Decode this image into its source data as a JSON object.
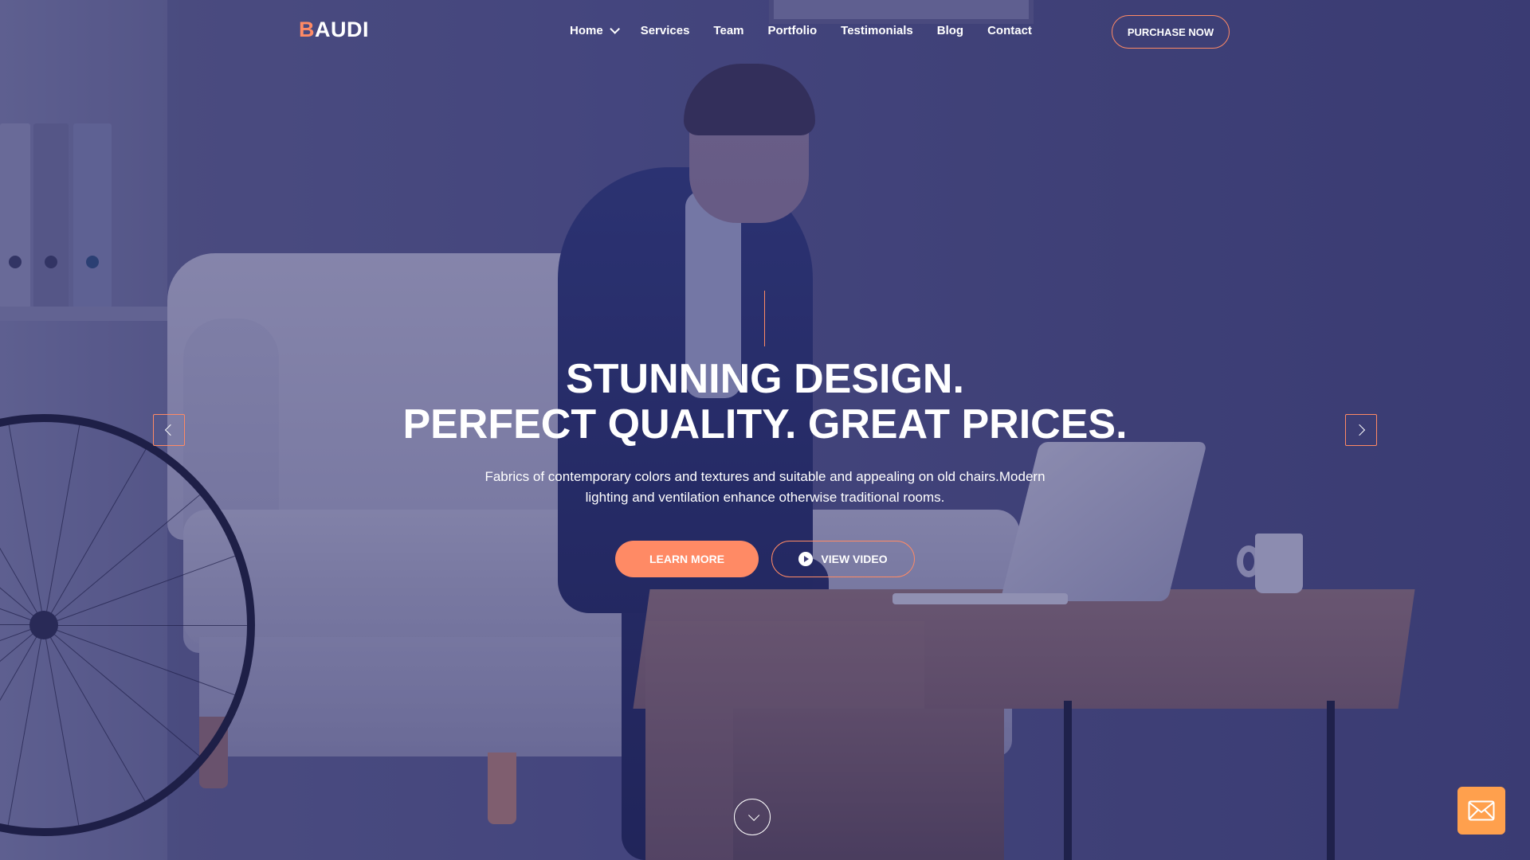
{
  "brand": {
    "logo_accent": "B",
    "logo_rest": "AUDI"
  },
  "nav": {
    "items": [
      {
        "label": "Home",
        "has_dropdown": true
      },
      {
        "label": "Services"
      },
      {
        "label": "Team"
      },
      {
        "label": "Portfolio"
      },
      {
        "label": "Testimonials"
      },
      {
        "label": "Blog"
      },
      {
        "label": "Contact"
      }
    ],
    "purchase_label": "PURCHASE NOW"
  },
  "hero": {
    "title_line1": "STUNNING DESIGN.",
    "title_line2": "PERFECT QUALITY. GREAT PRICES.",
    "description_line1": "Fabrics of contemporary colors and textures and suitable and appealing on old chairs.Modern",
    "description_line2": "lighting and ventilation enhance otherwise traditional rooms.",
    "learn_more_label": "LEARN MORE",
    "view_video_label": "VIEW VIDEO"
  },
  "icons": {
    "home_dropdown": "chevron-down-icon",
    "prev_slide": "chevron-left-icon",
    "next_slide": "chevron-right-icon",
    "play": "play-icon",
    "scroll_down": "chevron-down-icon",
    "contact": "mail-icon"
  },
  "colors": {
    "accent": "#ff8a65",
    "mail_button": "#ffa04d",
    "overlay": "#262466"
  }
}
